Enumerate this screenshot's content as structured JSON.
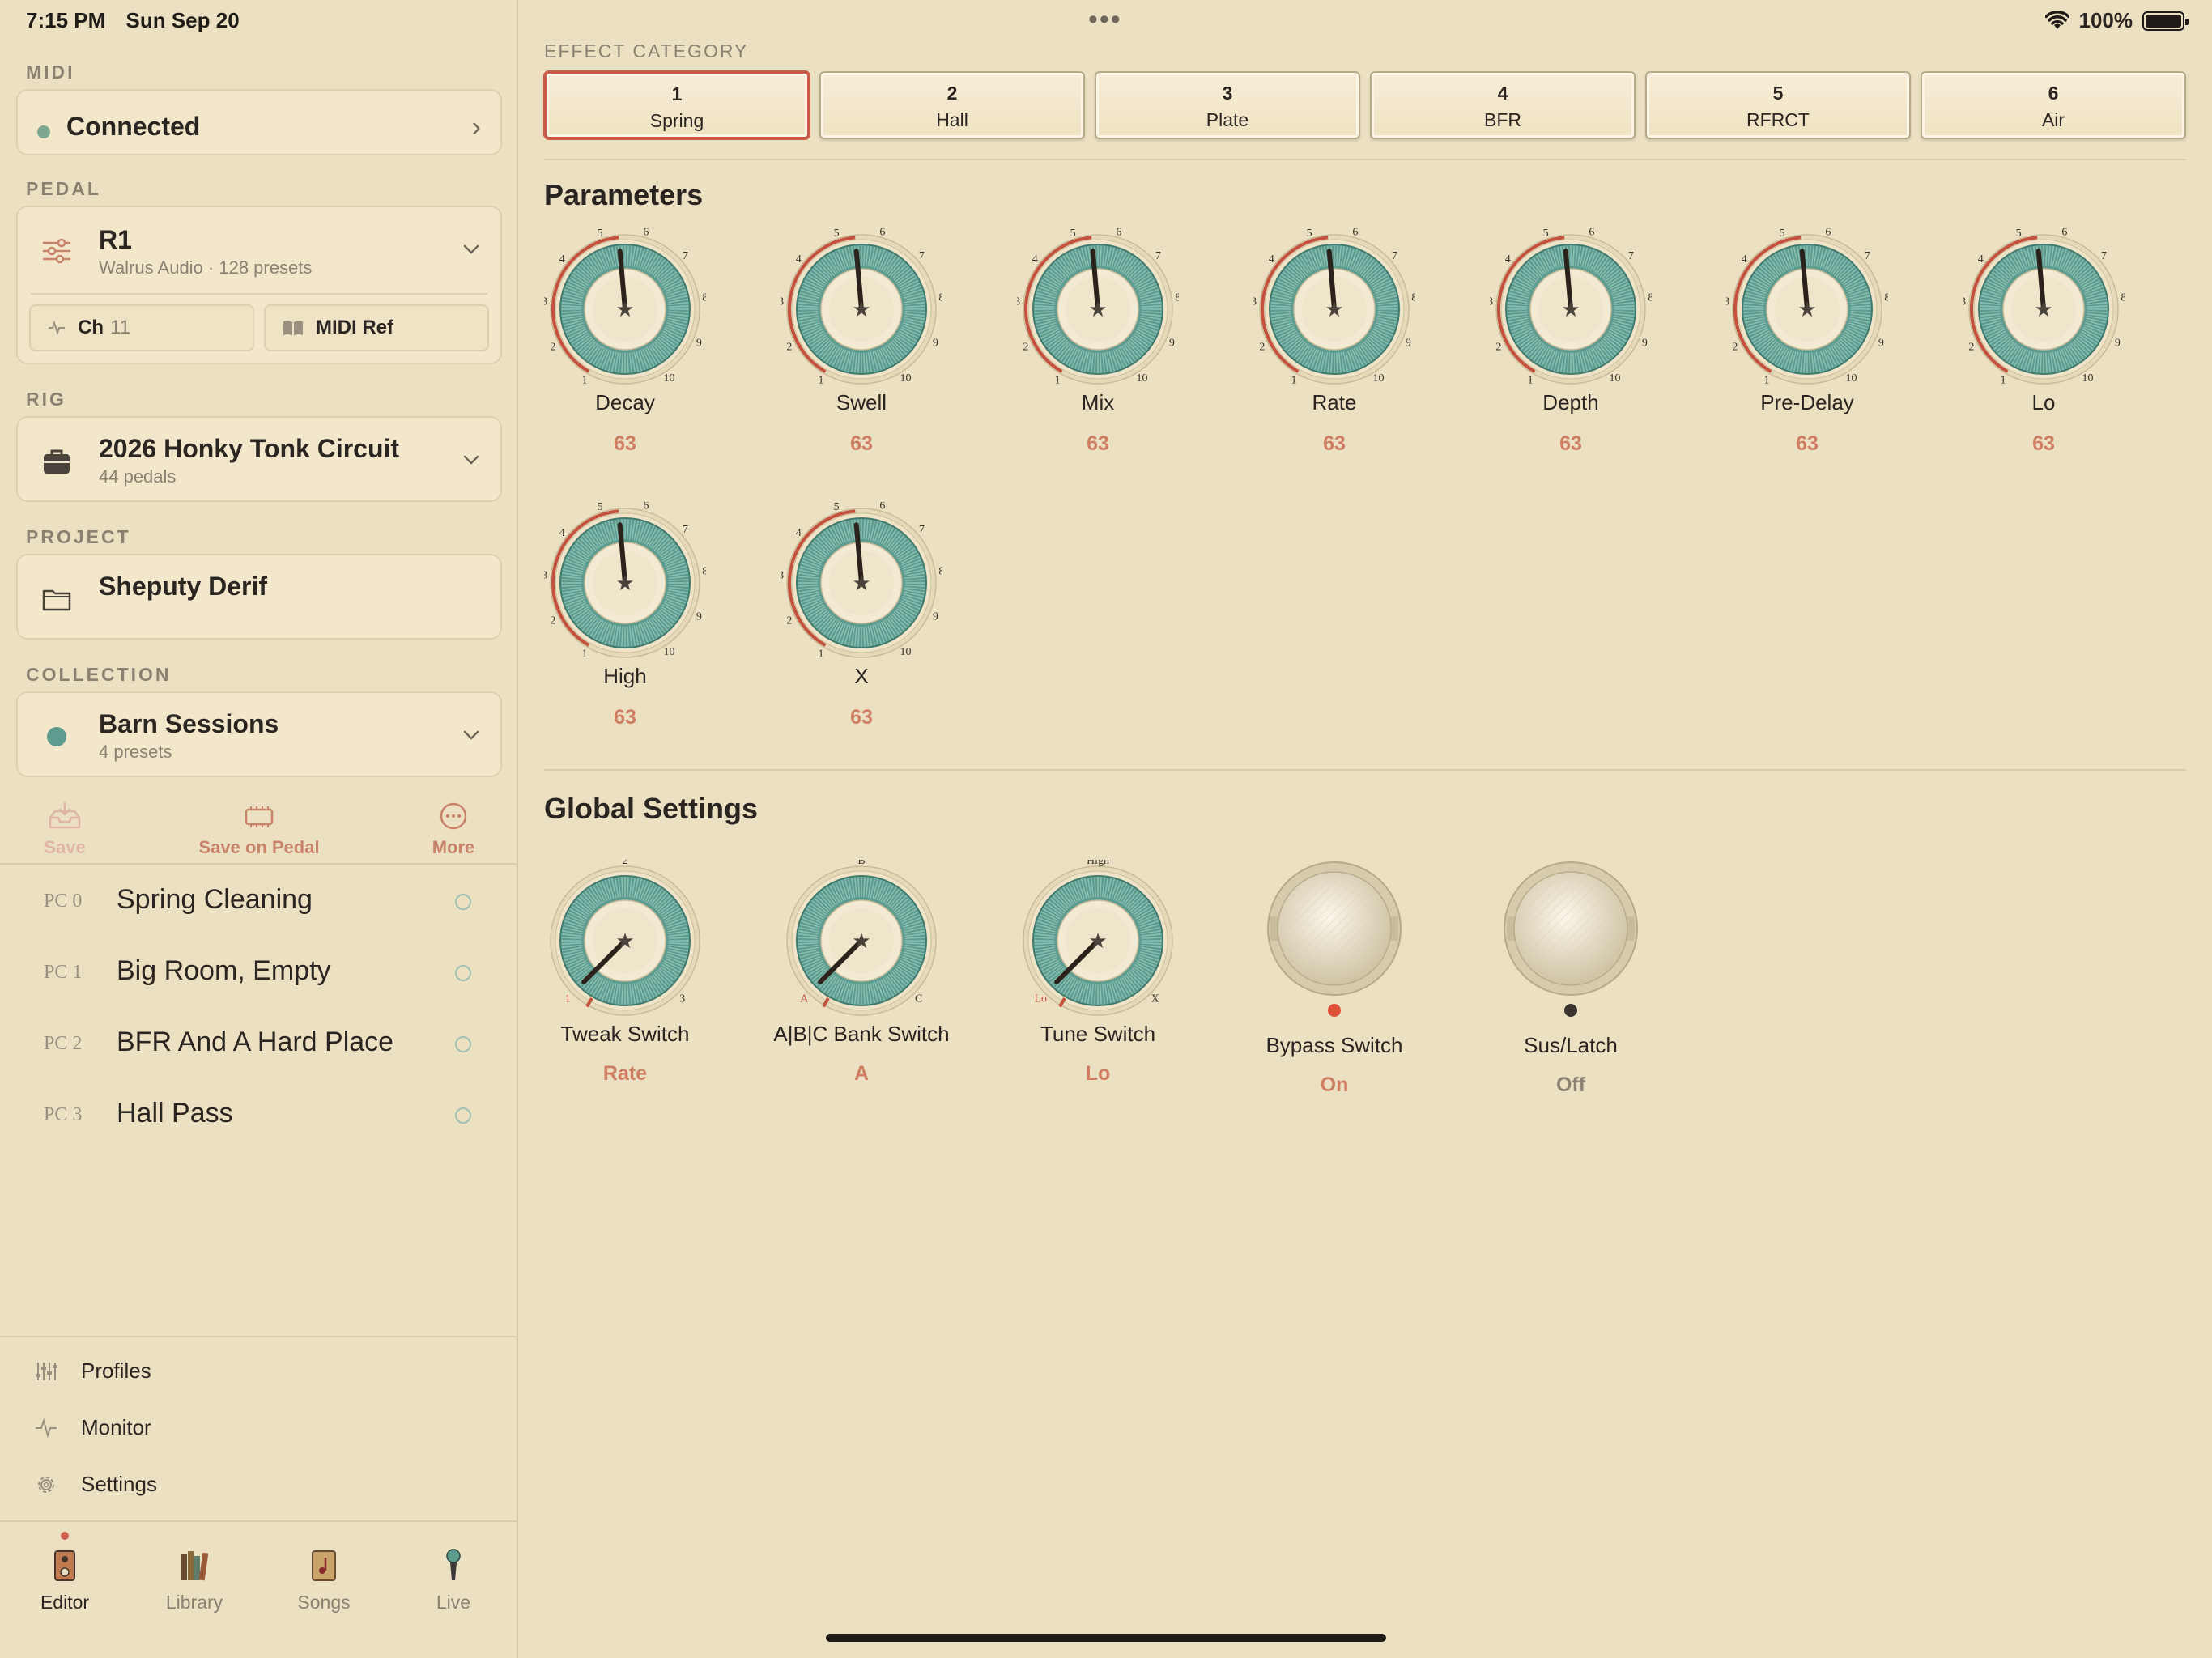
{
  "status": {
    "time": "7:15 PM",
    "date": "Sun Sep 20",
    "battery": "100%"
  },
  "colors": {
    "accent": "#c85a48",
    "teal": "#5e9c90",
    "background": "#ece0c3"
  },
  "sidebar": {
    "midi": {
      "label": "MIDI",
      "status": "Connected"
    },
    "pedal": {
      "label": "PEDAL",
      "name": "R1",
      "sub": "Walrus Audio · 128 presets",
      "channel_label": "Ch",
      "channel_value": "11",
      "midi_ref": "MIDI Ref"
    },
    "rig": {
      "label": "RIG",
      "name": "2026 Honky Tonk Circuit",
      "sub": "44 pedals"
    },
    "project": {
      "label": "PROJECT",
      "name": "Sheputy Derif"
    },
    "collection": {
      "label": "COLLECTION",
      "name": "Barn Sessions",
      "sub": "4 presets"
    },
    "actions": {
      "save": "Save",
      "save_on_pedal": "Save on Pedal",
      "more": "More"
    },
    "presets": [
      {
        "pc": "PC 0",
        "name": "Spring Cleaning"
      },
      {
        "pc": "PC 1",
        "name": "Big Room, Empty"
      },
      {
        "pc": "PC 2",
        "name": "BFR And A Hard Place"
      },
      {
        "pc": "PC 3",
        "name": "Hall Pass"
      }
    ],
    "links": {
      "profiles": "Profiles",
      "monitor": "Monitor",
      "settings": "Settings"
    },
    "tabs": {
      "editor": "Editor",
      "library": "Library",
      "songs": "Songs",
      "live": "Live"
    }
  },
  "main": {
    "effect_category_label": "EFFECT CATEGORY",
    "effects": [
      {
        "num": "1",
        "label": "Spring"
      },
      {
        "num": "2",
        "label": "Hall"
      },
      {
        "num": "3",
        "label": "Plate"
      },
      {
        "num": "4",
        "label": "BFR"
      },
      {
        "num": "5",
        "label": "RFRCT"
      },
      {
        "num": "6",
        "label": "Air"
      }
    ],
    "selected_effect": 0,
    "parameters_title": "Parameters",
    "knob_scale": [
      "1",
      "2",
      "3",
      "4",
      "5",
      "6",
      "7",
      "8",
      "9",
      "10"
    ],
    "parameters": [
      {
        "name": "Decay",
        "value": "63"
      },
      {
        "name": "Swell",
        "value": "63"
      },
      {
        "name": "Mix",
        "value": "63"
      },
      {
        "name": "Rate",
        "value": "63"
      },
      {
        "name": "Depth",
        "value": "63"
      },
      {
        "name": "Pre-Delay",
        "value": "63"
      },
      {
        "name": "Lo",
        "value": "63"
      },
      {
        "name": "High",
        "value": "63"
      },
      {
        "name": "X",
        "value": "63"
      }
    ],
    "global_title": "Global Settings",
    "global_knobs": [
      {
        "name": "Tweak Switch",
        "value": "Rate",
        "labels": [
          "1",
          "2",
          "3"
        ]
      },
      {
        "name": "A|B|C Bank Switch",
        "value": "A",
        "labels": [
          "A",
          "B",
          "C"
        ]
      },
      {
        "name": "Tune Switch",
        "value": "Lo",
        "labels": [
          "Lo",
          "High",
          "X"
        ]
      }
    ],
    "footswitches": [
      {
        "name": "Bypass Switch",
        "value": "On",
        "led": "#e0513a",
        "value_color": "#cf7d63"
      },
      {
        "name": "Sus/Latch",
        "value": "Off",
        "led": "#3a342c",
        "value_color": "#8b8171"
      }
    ]
  }
}
